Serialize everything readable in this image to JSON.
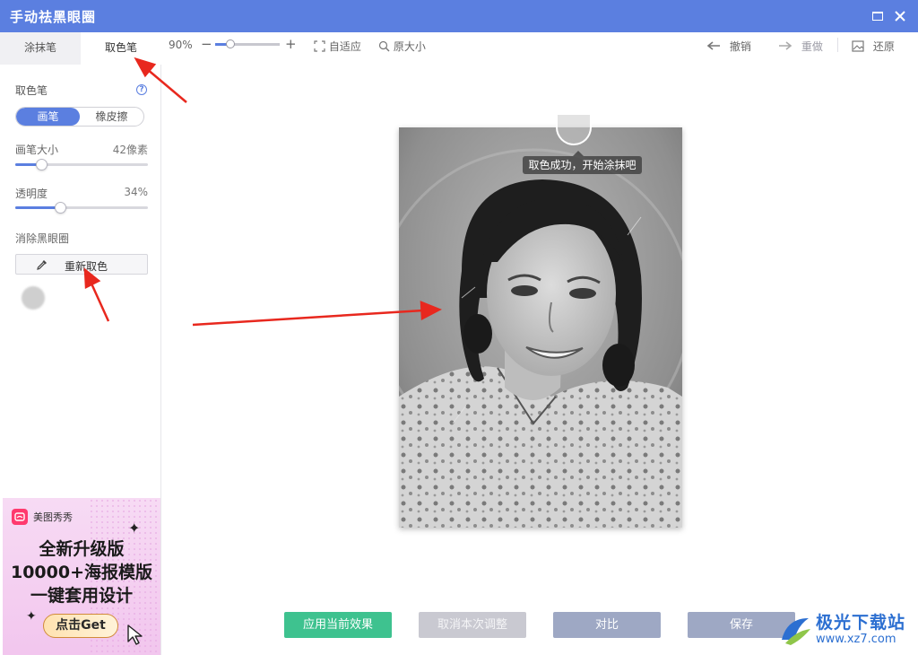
{
  "window": {
    "title": "手动祛黑眼圈"
  },
  "left_panel": {
    "tabs": [
      {
        "label": "涂抹笔",
        "active": false
      },
      {
        "label": "取色笔",
        "active": true
      }
    ],
    "section_title": "取色笔",
    "help_glyph": "?",
    "mode_toggle": {
      "options": [
        "画笔",
        "橡皮擦"
      ],
      "selected": "画笔"
    },
    "brush_size": {
      "label": "画笔大小",
      "value_text": "42像素",
      "level": 0.2
    },
    "opacity": {
      "label": "透明度",
      "value_text": "34%",
      "level": 0.34
    },
    "remove_section_title": "消除黑眼圈",
    "resample_button": "重新取色",
    "sampled_color": "#cfcfcf"
  },
  "ad": {
    "brand": "美图秀秀",
    "lines": [
      "全新升级版",
      "10000+海报模版",
      "一键套用设计"
    ],
    "cta": "点击Get"
  },
  "toolbar": {
    "zoom_text": "90%",
    "zoom_level": 0.24,
    "fit_label": "自适应",
    "original_size_label": "原大小",
    "undo_label": "撤销",
    "redo_label": "重做",
    "restore_label": "还原"
  },
  "canvas": {
    "tooltip": "取色成功，开始涂抹吧"
  },
  "actions": {
    "apply": "应用当前效果",
    "cancel": "取消本次调整",
    "compare": "对比",
    "save": "保存"
  },
  "watermark": {
    "name": "极光下载站",
    "url": "www.xz7.com"
  },
  "colors": {
    "accent": "#5b7fe0",
    "apply_green": "#3ec28f",
    "annotation_red": "#e8281e"
  }
}
